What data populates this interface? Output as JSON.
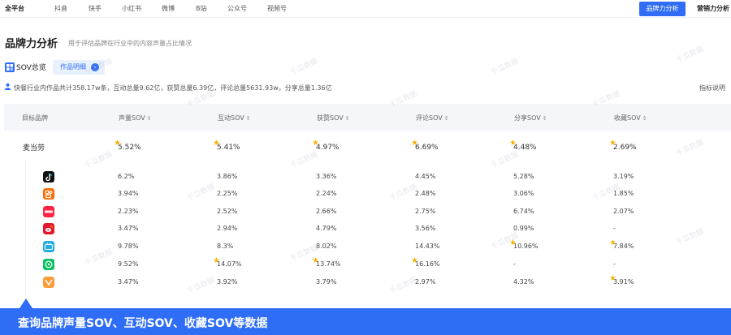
{
  "platform_tabs": [
    "全平台",
    "抖音",
    "快手",
    "小红书",
    "微博",
    "B站",
    "公众号",
    "视频号"
  ],
  "top_buttons": {
    "brand_analysis": "品牌力分析",
    "marketing_analysis": "营销力分析"
  },
  "page": {
    "title": "品牌力分析",
    "subtitle": "用于评估品牌在行业中的内容声量占比情况"
  },
  "sov": {
    "title": "SOV总览",
    "detail_button": "作品明细"
  },
  "summary": {
    "text": "快餐行业内作品共计358.17w条，互动总量9.62亿，获赞总量6.39亿，评论总量5631.93w，分享总量1.36亿",
    "metric_link": "指标说明"
  },
  "table": {
    "headers": [
      "目标品牌",
      "声量SOV",
      "互动SOV",
      "获赞SOV",
      "评论SOV",
      "分享SOV",
      "收藏SOV"
    ],
    "brand": {
      "name": "麦当劳",
      "values": [
        "5.52%",
        "5.41%",
        "4.97%",
        "6.69%",
        "4.48%",
        "2.69%"
      ]
    },
    "platform_rows": [
      {
        "icon": "douyin-icon",
        "values": [
          "6.2%",
          "3.86%",
          "3.36%",
          "4.45%",
          "5.28%",
          "3.19%"
        ]
      },
      {
        "icon": "kuaishou-icon",
        "values": [
          "3.94%",
          "2.25%",
          "2.24%",
          "2.48%",
          "3.06%",
          "1.85%"
        ]
      },
      {
        "icon": "xiaohongshu-icon",
        "values": [
          "2.23%",
          "2.52%",
          "2.66%",
          "2.75%",
          "6.74%",
          "2.07%"
        ]
      },
      {
        "icon": "weibo-icon",
        "values": [
          "3.47%",
          "2.94%",
          "4.79%",
          "3.56%",
          "0.99%",
          "-"
        ]
      },
      {
        "icon": "bilibili-icon",
        "values": [
          "9.78%",
          "8.3%",
          "8.02%",
          "14.43%",
          "10.96%",
          "7.84%"
        ]
      },
      {
        "icon": "wechat-official-icon",
        "values": [
          "9.52%",
          "14.07%",
          "13.74%",
          "16.16%",
          "-",
          "-"
        ]
      },
      {
        "icon": "channels-icon",
        "values": [
          "3.47%",
          "3.92%",
          "3.79%",
          "2.97%",
          "4.32%",
          "3.91%"
        ]
      }
    ]
  },
  "watermark_text": "千瓜数据",
  "banner": {
    "text": "查询品牌声量SOV、互动SOV、收藏SOV等数据"
  },
  "colors": {
    "accent": "#2f6df6",
    "star": "#f5b400",
    "header_bg": "#f4f6f9"
  }
}
